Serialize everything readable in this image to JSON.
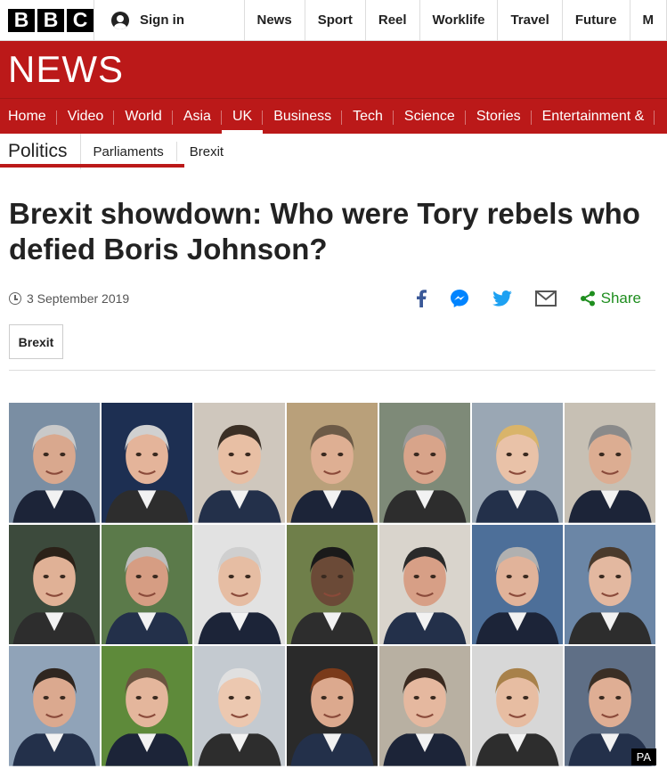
{
  "brand": {
    "letters": [
      "B",
      "B",
      "C"
    ]
  },
  "account": {
    "signin_label": "Sign in"
  },
  "top_nav": [
    "News",
    "Sport",
    "Reel",
    "Worklife",
    "Travel",
    "Future",
    "M"
  ],
  "banner": {
    "title": "NEWS"
  },
  "main_nav": [
    "Home",
    "Video",
    "World",
    "Asia",
    "UK",
    "Business",
    "Tech",
    "Science",
    "Stories",
    "Entertainment &"
  ],
  "main_nav_active": "UK",
  "sub_nav": {
    "section": "Politics",
    "items": [
      "Parliaments",
      "Brexit"
    ]
  },
  "article": {
    "headline": "Brexit showdown: Who were Tory rebels who defied Boris Johnson?",
    "date": "3 September 2019",
    "share_label": "Share",
    "tag": "Brexit",
    "image_credit": "PA"
  },
  "colors": {
    "brand_red": "#bb1919",
    "share_green": "#1f8e1f",
    "facebook_blue": "#3b5998",
    "twitter_blue": "#1da1f2"
  },
  "photo_grid": {
    "rows": 3,
    "cols": 7
  }
}
